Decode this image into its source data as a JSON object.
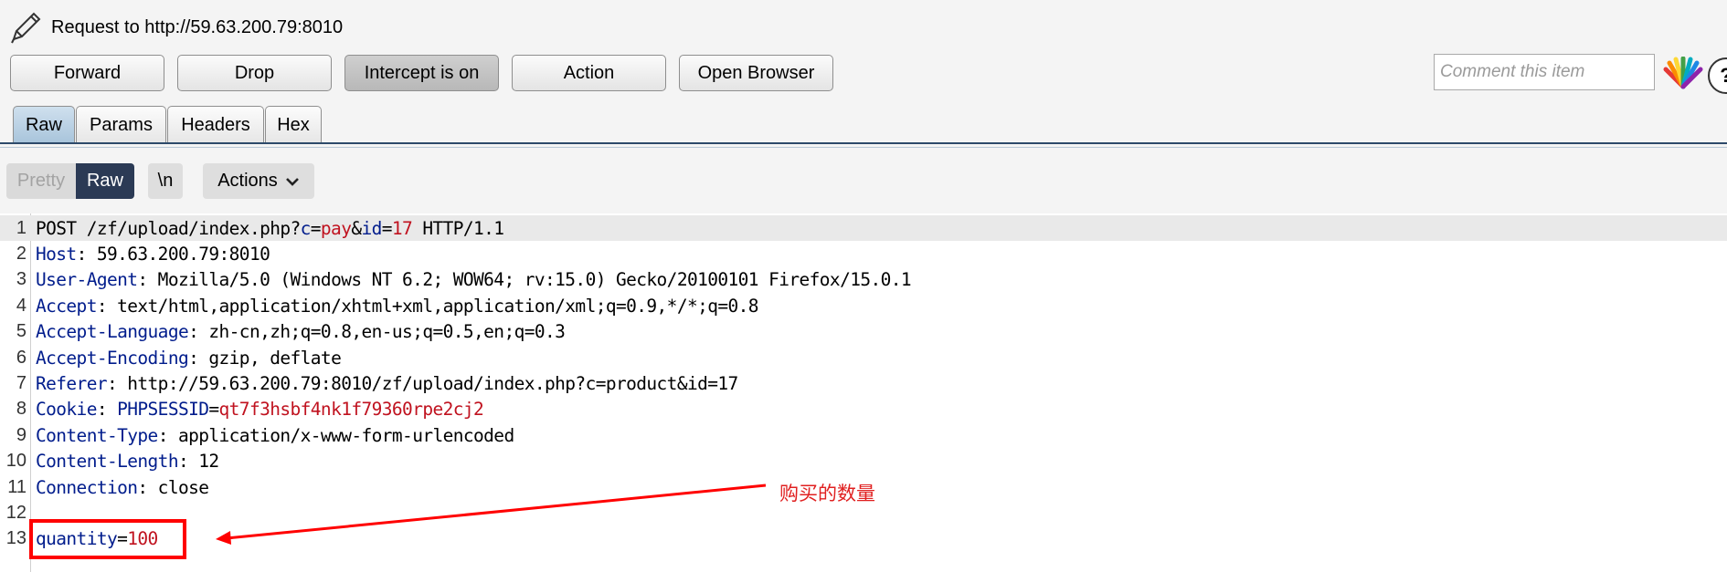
{
  "header": {
    "title": "Request to http://59.63.200.79:8010"
  },
  "toolbar": {
    "forward": "Forward",
    "drop": "Drop",
    "intercept": "Intercept is on",
    "action": "Action",
    "open_browser": "Open Browser",
    "comment_placeholder": "Comment this item",
    "help": "?"
  },
  "tabs": [
    "Raw",
    "Params",
    "Headers",
    "Hex"
  ],
  "editor_toolbar": {
    "pretty": "Pretty",
    "raw": "Raw",
    "newline": "\\n",
    "actions": "Actions"
  },
  "request_lines": [
    {
      "num": "1",
      "parts": [
        [
          "t",
          "POST /zf/upload/index.php?"
        ],
        [
          "k",
          "c"
        ],
        [
          "t",
          "="
        ],
        [
          "v",
          "pay"
        ],
        [
          "t",
          "&"
        ],
        [
          "k",
          "id"
        ],
        [
          "t",
          "="
        ],
        [
          "v",
          "17"
        ],
        [
          "t",
          " HTTP/1.1"
        ]
      ]
    },
    {
      "num": "2",
      "parts": [
        [
          "k",
          "Host"
        ],
        [
          "t",
          ": 59.63.200.79:8010"
        ]
      ]
    },
    {
      "num": "3",
      "parts": [
        [
          "k",
          "User-Agent"
        ],
        [
          "t",
          ": Mozilla/5.0 (Windows NT 6.2; WOW64; rv:15.0) Gecko/20100101 Firefox/15.0.1"
        ]
      ]
    },
    {
      "num": "4",
      "parts": [
        [
          "k",
          "Accept"
        ],
        [
          "t",
          ": text/html,application/xhtml+xml,application/xml;q=0.9,*/*;q=0.8"
        ]
      ]
    },
    {
      "num": "5",
      "parts": [
        [
          "k",
          "Accept-Language"
        ],
        [
          "t",
          ": zh-cn,zh;q=0.8,en-us;q=0.5,en;q=0.3"
        ]
      ]
    },
    {
      "num": "6",
      "parts": [
        [
          "k",
          "Accept-Encoding"
        ],
        [
          "t",
          ": gzip, deflate"
        ]
      ]
    },
    {
      "num": "7",
      "parts": [
        [
          "k",
          "Referer"
        ],
        [
          "t",
          ": http://59.63.200.79:8010/zf/upload/index.php?c=product&id=17"
        ]
      ]
    },
    {
      "num": "8",
      "parts": [
        [
          "k",
          "Cookie"
        ],
        [
          "t",
          ": "
        ],
        [
          "k",
          "PHPSESSID"
        ],
        [
          "t",
          "="
        ],
        [
          "v",
          "qt7f3hsbf4nk1f79360rpe2cj2"
        ]
      ]
    },
    {
      "num": "9",
      "parts": [
        [
          "k",
          "Content-Type"
        ],
        [
          "t",
          ": application/x-www-form-urlencoded"
        ]
      ]
    },
    {
      "num": "10",
      "parts": [
        [
          "k",
          "Content-Length"
        ],
        [
          "t",
          ": 12"
        ]
      ]
    },
    {
      "num": "11",
      "parts": [
        [
          "k",
          "Connection"
        ],
        [
          "t",
          ": close"
        ]
      ]
    },
    {
      "num": "12",
      "parts": []
    },
    {
      "num": "13",
      "parts": [
        [
          "k",
          "quantity"
        ],
        [
          "t",
          "="
        ],
        [
          "v",
          "100"
        ]
      ]
    }
  ],
  "annotation": "购买的数量",
  "colors": {
    "key": "#001c8c",
    "value": "#c0121f",
    "annotation": "#e02020",
    "raw_toggle": "#2b3a55"
  }
}
